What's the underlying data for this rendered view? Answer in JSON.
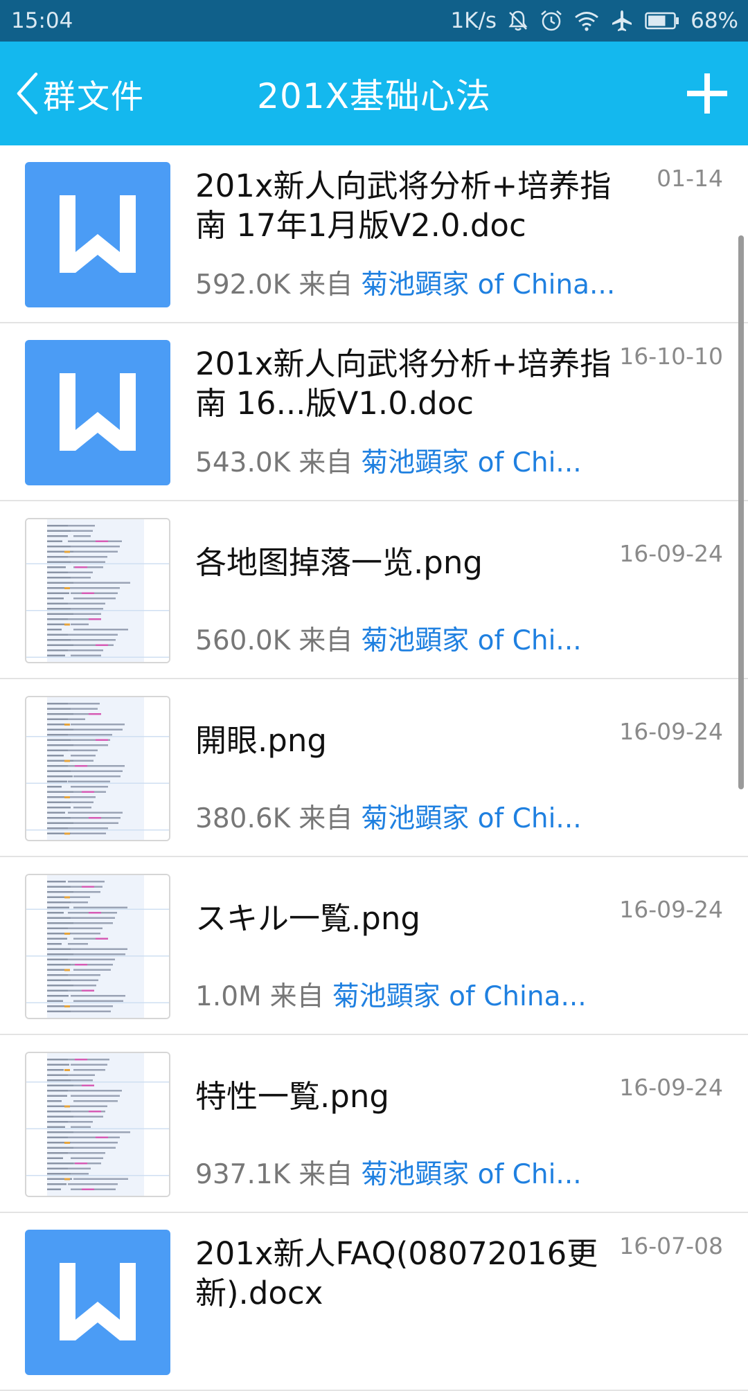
{
  "status_bar": {
    "time": "15:04",
    "network_speed": "1K/s",
    "battery_percent": "68%",
    "icons": [
      "bell-off-icon",
      "alarm-icon",
      "wifi-icon",
      "airplane-icon",
      "battery-icon"
    ],
    "battery_level": 0.68
  },
  "nav": {
    "back_label": "群文件",
    "title": "201X基础心法",
    "add_icon": "plus-icon"
  },
  "colors": {
    "status_bar_bg": "#10608a",
    "nav_bg": "#14b8ee",
    "word_icon_bg": "#4b9cf5",
    "uploader_link": "#1f80e0"
  },
  "files": [
    {
      "type": "word",
      "name": "201x新人向武将分析+培养指南 17年1月版V2.0.doc",
      "size": "592.0K",
      "from_label": "来自",
      "uploader": "菊池顕家 of China...",
      "date": "01-14"
    },
    {
      "type": "word",
      "name": "201x新人向武将分析+培养指南 16...版V1.0.doc",
      "size": "543.0K",
      "from_label": "来自",
      "uploader": "菊池顕家 of Chi...",
      "date": "16-10-10"
    },
    {
      "type": "image",
      "name": "各地图掉落一览.png",
      "size": "560.0K",
      "from_label": "来自",
      "uploader": "菊池顕家 of Chi...",
      "date": "16-09-24"
    },
    {
      "type": "image",
      "name": "開眼.png",
      "size": "380.6K",
      "from_label": "来自",
      "uploader": "菊池顕家 of Chi...",
      "date": "16-09-24"
    },
    {
      "type": "image",
      "name": "スキル一覧.png",
      "size": "1.0M",
      "from_label": "来自",
      "uploader": "菊池顕家 of China...",
      "date": "16-09-24"
    },
    {
      "type": "image",
      "name": "特性一覧.png",
      "size": "937.1K",
      "from_label": "来自",
      "uploader": "菊池顕家 of Chi...",
      "date": "16-09-24"
    },
    {
      "type": "word",
      "name": "201x新人FAQ(08072016更新).docx",
      "size": "",
      "from_label": "",
      "uploader": "",
      "date": "16-07-08"
    }
  ]
}
